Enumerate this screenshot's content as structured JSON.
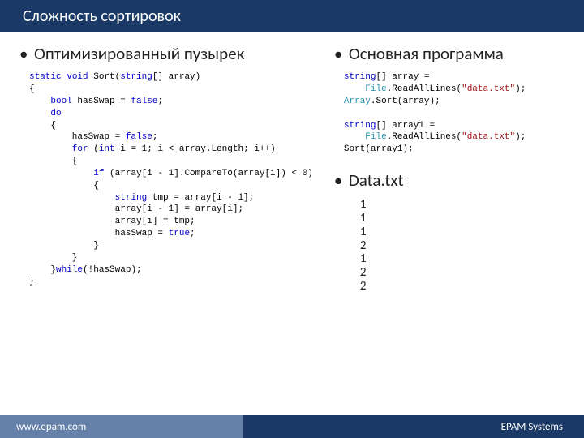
{
  "header": {
    "title": "Сложность сортировок"
  },
  "left": {
    "heading": "Оптимизированный пузырек",
    "code": {
      "l1a": "static",
      "l1b": "void",
      "l1c": " Sort(",
      "l1d": "string",
      "l1e": "[] array)",
      "l2": "{",
      "l3a": "    bool",
      "l3b": " hasSwap = ",
      "l3c": "false",
      "l3d": ";",
      "l4a": "    do",
      "l5": "    {",
      "l6a": "        hasSwap = ",
      "l6b": "false",
      "l6c": ";",
      "l7a": "        for",
      "l7b": " (",
      "l7c": "int",
      "l7d": " i = 1; i < array.Length; i++)",
      "l8": "        {",
      "l9a": "            if",
      "l9b": " (array[i - 1].CompareTo(array[i]) < 0)",
      "l10": "            {",
      "l11a": "                string",
      "l11b": " tmp = array[i - 1];",
      "l12": "                array[i - 1] = array[i];",
      "l13": "                array[i] = tmp;",
      "l14a": "                hasSwap = ",
      "l14b": "true",
      "l14c": ";",
      "l15": "            }",
      "l16": "        }",
      "l17a": "    }",
      "l17b": "while",
      "l17c": "(!hasSwap);",
      "l18": "}"
    }
  },
  "right": {
    "heading1": "Основная программа",
    "code1": {
      "l1a": "string",
      "l1b": "[] array =",
      "l2a": "    File",
      "l2b": ".ReadAllLines(",
      "l2c": "\"data.txt\"",
      "l2d": ");",
      "l3a": "Array",
      "l3b": ".Sort(array);",
      "blank": " ",
      "l4a": "string",
      "l4b": "[] array1 =",
      "l5a": "    File",
      "l5b": ".ReadAllLines(",
      "l5c": "\"data.txt\"",
      "l5d": ");",
      "l6": "Sort(array1);"
    },
    "heading2": "Data.txt",
    "datavals": "1\n1\n1\n2\n1\n2\n2"
  },
  "footer": {
    "left": "www.epam.com",
    "right": "EPAM Systems"
  }
}
